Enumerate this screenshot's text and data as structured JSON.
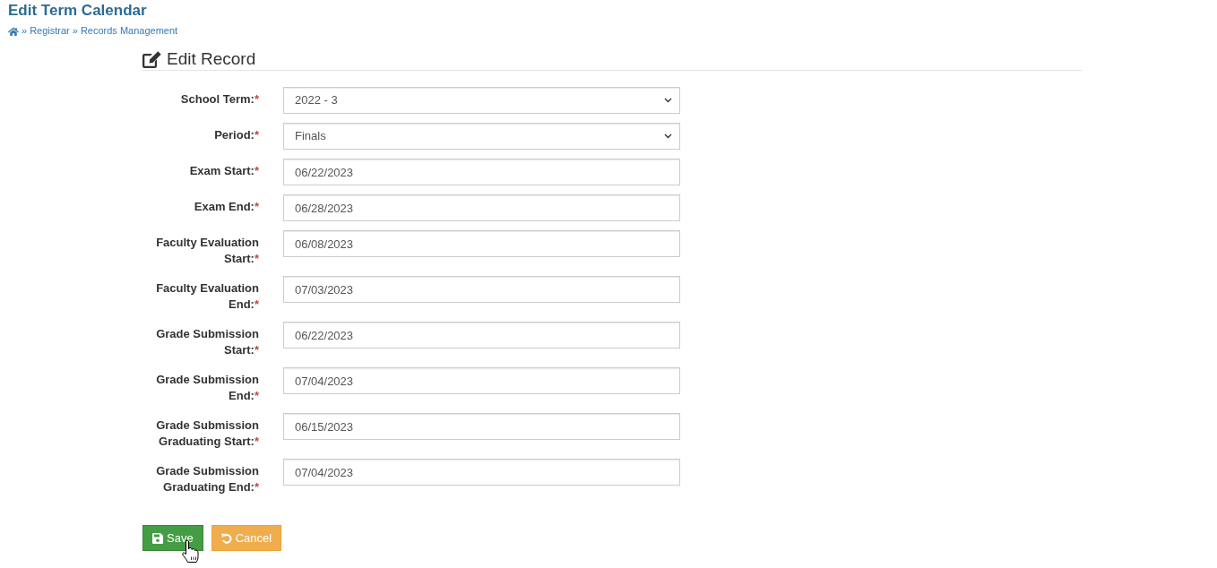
{
  "page": {
    "title": "Edit Term Calendar"
  },
  "breadcrumb": [
    {
      "kind": "home"
    },
    {
      "kind": "separator",
      "text": "»"
    },
    {
      "kind": "link",
      "text": "Registrar"
    },
    {
      "kind": "separator",
      "text": "»"
    },
    {
      "kind": "link",
      "text": "Records Management"
    }
  ],
  "form": {
    "heading": "Edit Record",
    "fields": [
      {
        "label": "School Term:",
        "required_mark": "*",
        "kind": "select",
        "value": "2022 - 3"
      },
      {
        "label": "Period:",
        "required_mark": "*",
        "kind": "select",
        "value": "Finals"
      },
      {
        "label": "Exam Start:",
        "required_mark": "*",
        "kind": "date",
        "value": "06/22/2023"
      },
      {
        "label": "Exam End:",
        "required_mark": "*",
        "kind": "date",
        "value": "06/28/2023"
      },
      {
        "label": "Faculty Evaluation Start:",
        "required_mark": "*",
        "kind": "date",
        "value": "06/08/2023"
      },
      {
        "label": "Faculty Evaluation End:",
        "required_mark": "*",
        "kind": "date",
        "value": "07/03/2023"
      },
      {
        "label": "Grade Submission Start:",
        "required_mark": "*",
        "kind": "date",
        "value": "06/22/2023"
      },
      {
        "label": "Grade Submission End:",
        "required_mark": "*",
        "kind": "date",
        "value": "07/04/2023"
      },
      {
        "label": "Grade Submission Graduating Start:",
        "required_mark": "*",
        "kind": "date",
        "value": "06/15/2023"
      },
      {
        "label": "Grade Submission Graduating End:",
        "required_mark": "*",
        "kind": "date",
        "value": "07/04/2023"
      }
    ],
    "buttons": [
      {
        "kind": "save",
        "label": "Save"
      },
      {
        "kind": "cancel",
        "label": "Cancel"
      }
    ]
  }
}
